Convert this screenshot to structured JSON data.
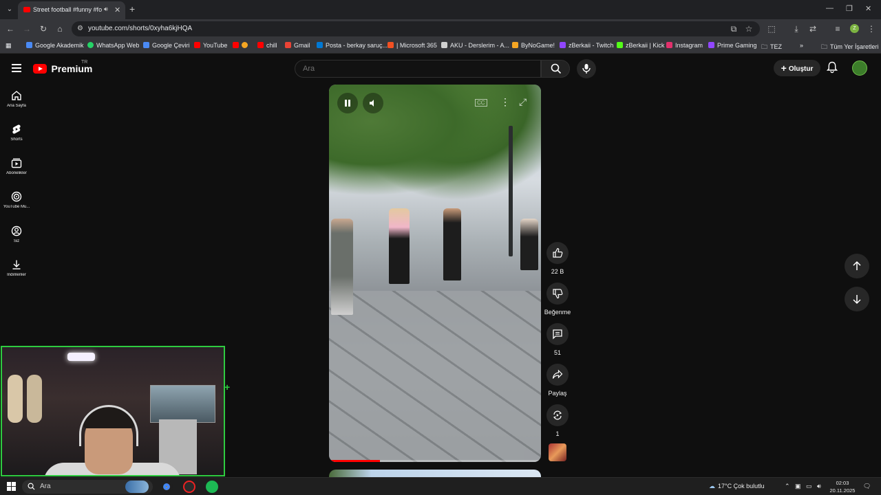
{
  "browser": {
    "tab_title": "Street football #funny #fory",
    "url": "youtube.com/shorts/0xyha6kjHQA",
    "bookmarks": [
      {
        "label": "Google Akademik",
        "color": "#4a8af4"
      },
      {
        "label": "WhatsApp Web",
        "color": "#25d366"
      },
      {
        "label": "Google Çeviri",
        "color": "#4a8af4"
      },
      {
        "label": "YouTube",
        "color": "#ff0000"
      },
      {
        "label": "",
        "color": "#ff0000"
      },
      {
        "label": "chill",
        "color": "#ff0000"
      },
      {
        "label": "Gmail",
        "color": "#ea4335"
      },
      {
        "label": "Posta - berkay saruç...",
        "color": "#0078d4"
      },
      {
        "label": "| Microsoft 365",
        "color": "#f25022"
      },
      {
        "label": "AKU - Derslerim - A...",
        "color": "#d0d0d0"
      },
      {
        "label": "ByNoGame!",
        "color": "#f5a623"
      },
      {
        "label": "zBerkaii - Twitch",
        "color": "#9146ff"
      },
      {
        "label": "zBerkaii | Kick",
        "color": "#53fc18"
      },
      {
        "label": "Instagram",
        "color": "#e1306c"
      },
      {
        "label": "Prime Gaming",
        "color": "#9146ff"
      },
      {
        "label": "TEZ",
        "color": "#c8c8c8"
      }
    ],
    "all_bookmarks": "Tüm Yer İşaretleri",
    "profile_letter": "Z"
  },
  "youtube": {
    "brand": "Premium",
    "region": "TR",
    "search_placeholder": "Ara",
    "create_label": "Oluştur",
    "sidebar": [
      {
        "label": "Ana Sayfa",
        "icon": "home-icon"
      },
      {
        "label": "Shorts",
        "icon": "shorts-icon"
      },
      {
        "label": "Abonelikler",
        "icon": "subscriptions-icon"
      },
      {
        "label": "YouTube Mu...",
        "icon": "youtube-music-icon"
      },
      {
        "label": "Siz",
        "icon": "you-icon"
      },
      {
        "label": "İndirilenler",
        "icon": "downloads-icon"
      }
    ],
    "actions": {
      "like_count": "22 B",
      "dislike_label": "Beğenme",
      "comment_count": "51",
      "share_label": "Paylaş",
      "remix_count": "1"
    },
    "progress": 0.24
  },
  "taskbar": {
    "search_label": "Ara",
    "weather": "17°C  Çok bulutlu",
    "time": "02:03",
    "date": "20.11.2025"
  }
}
